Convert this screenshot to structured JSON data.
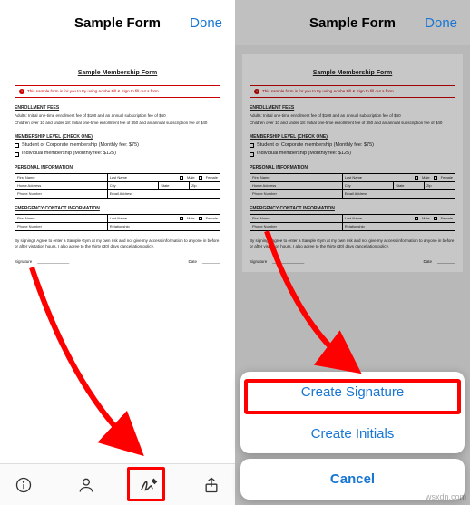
{
  "watermark": "wsxdn.com",
  "left": {
    "header": {
      "title": "Sample Form",
      "done": "Done"
    },
    "doc": {
      "title": "Sample Membership Form",
      "notice": "This sample form is for you to try using Adobe Fill & Sign to fill out a form.",
      "fees": {
        "title": "ENROLLMENT FEES",
        "line1": "Adults: Initial one-time enrollment fee of $100 and an annual subscription fee of $60",
        "line2": "Children over 10 and under 18: Initial one-time enrollment fee of $50 and an annual subscription fee of $40"
      },
      "level": {
        "title": "MEMBERSHIP LEVEL (CHECK ONE)",
        "opt1": "Student or Corporate membership (Monthly fee: $75)",
        "opt2": "Individual membership (Monthly fee: $125)"
      },
      "personal": {
        "title": "PERSONAL INFORMATION",
        "first": "First Name",
        "last": "Last Name",
        "male": "Male",
        "female": "Female",
        "home": "Home Address",
        "city": "City",
        "state": "State",
        "zip": "Zip",
        "phone": "Phone Number",
        "email": "Email Address"
      },
      "emergency": {
        "title": "EMERGENCY CONTACT INFORMATION",
        "first": "First Name",
        "last": "Last Name",
        "male": "Male",
        "female": "Female",
        "phone": "Phone Number",
        "rel": "Relationship"
      },
      "agreement": "By signing I Agree to enter a Sample Gym at my own risk and not give my access information to anyone in before or after visitation hours. I also agree to the thirty (30) days cancellation policy.",
      "sig": "Signature",
      "date": "Date"
    }
  },
  "right": {
    "header": {
      "title": "Sample Form",
      "done": "Done"
    },
    "sheet": {
      "create_signature": "Create Signature",
      "create_initials": "Create Initials",
      "cancel": "Cancel"
    }
  }
}
